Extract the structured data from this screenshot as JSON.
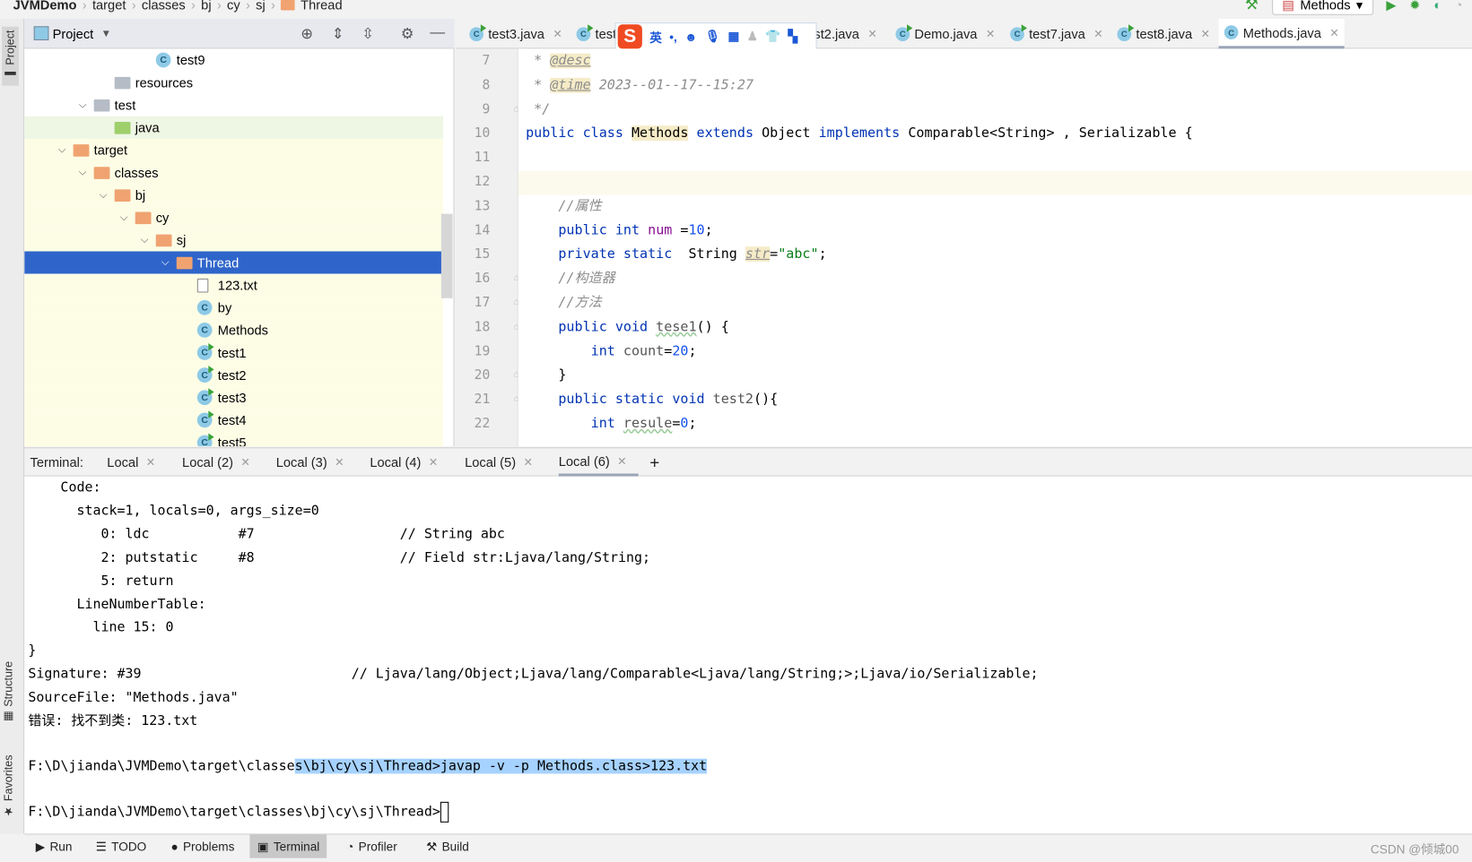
{
  "breadcrumb": [
    "JVMDemo",
    "target",
    "classes",
    "bj",
    "cy",
    "sj",
    "Thread"
  ],
  "toolbar": {
    "run_config": "Methods",
    "hammer_icon": "hammer-icon",
    "run_icon": "run-icon",
    "debug_icon": "debug-icon",
    "coverage_icon": "coverage-icon"
  },
  "left_strip": {
    "project": "Project",
    "structure": "Structure",
    "favorites": "Favorites"
  },
  "project_panel": {
    "title": "Project",
    "tree": [
      {
        "label": "test9",
        "icon": "cls",
        "level": 5
      },
      {
        "label": "resources",
        "icon": "res",
        "level": 3
      },
      {
        "label": "test",
        "icon": "plain",
        "level": 2,
        "expanded": true
      },
      {
        "label": "java",
        "icon": "gfold",
        "level": 3,
        "highlight": true
      },
      {
        "label": "target",
        "icon": "fold",
        "level": 1,
        "expanded": true,
        "yellow": true
      },
      {
        "label": "classes",
        "icon": "fold",
        "level": 2,
        "expanded": true,
        "yellow": true
      },
      {
        "label": "bj",
        "icon": "fold",
        "level": 3,
        "expanded": true,
        "yellow": true
      },
      {
        "label": "cy",
        "icon": "fold",
        "level": 4,
        "expanded": true,
        "yellow": true
      },
      {
        "label": "sj",
        "icon": "fold",
        "level": 5,
        "expanded": true,
        "yellow": true
      },
      {
        "label": "Thread",
        "icon": "fold",
        "level": 6,
        "expanded": true,
        "selected": true
      },
      {
        "label": "123.txt",
        "icon": "txt",
        "level": 7,
        "yellow": true
      },
      {
        "label": "by",
        "icon": "cls",
        "level": 7,
        "yellow": true
      },
      {
        "label": "Methods",
        "icon": "cls",
        "level": 7,
        "yellow": true
      },
      {
        "label": "test1",
        "icon": "run",
        "level": 7,
        "yellow": true
      },
      {
        "label": "test2",
        "icon": "run",
        "level": 7,
        "yellow": true
      },
      {
        "label": "test3",
        "icon": "run",
        "level": 7,
        "yellow": true
      },
      {
        "label": "test4",
        "icon": "run",
        "level": 7,
        "yellow": true
      },
      {
        "label": "test5",
        "icon": "run",
        "level": 7,
        "yellow": true
      }
    ]
  },
  "editor_tabs": [
    {
      "label": "test3.java",
      "run": true
    },
    {
      "label": "test5",
      "run": true
    },
    {
      "label": "st2.java",
      "run": true
    },
    {
      "label": "Demo.java",
      "run": true
    },
    {
      "label": "test7.java",
      "run": true
    },
    {
      "label": "test8.java",
      "run": true
    },
    {
      "label": "Methods.java",
      "run": false,
      "active": true
    }
  ],
  "ime_toolbar": {
    "logo": "S",
    "lang": "英",
    "punct": "•,"
  },
  "editor": {
    "current_line": 12,
    "lines": [
      {
        "n": 7,
        "t": [
          [
            "cmt",
            " * "
          ],
          [
            "tag",
            "@desc"
          ]
        ]
      },
      {
        "n": 8,
        "t": [
          [
            "cmt",
            " * "
          ],
          [
            "tag",
            "@time"
          ],
          [
            "cmt",
            " 2023--01--17--15:27"
          ]
        ]
      },
      {
        "n": 9,
        "t": [
          [
            "cmt",
            " */"
          ]
        ]
      },
      {
        "n": 10,
        "t": [
          [
            "kw",
            "public class "
          ],
          [
            "hlw",
            "Methods"
          ],
          [
            "kw",
            " extends "
          ],
          [
            "",
            "Object "
          ],
          [
            "kw",
            "implements "
          ],
          [
            "",
            "Comparable<String> , Serializable {"
          ]
        ]
      },
      {
        "n": 11,
        "t": []
      },
      {
        "n": 12,
        "t": []
      },
      {
        "n": 13,
        "t": [
          [
            "cmt",
            "    //属性"
          ]
        ]
      },
      {
        "n": 14,
        "t": [
          [
            "kw",
            "    public int "
          ],
          [
            "fld",
            "num"
          ],
          [
            "",
            " ="
          ],
          [
            "num",
            "10"
          ],
          [
            "",
            ";"
          ]
        ]
      },
      {
        "n": 15,
        "t": [
          [
            "kw",
            "    private static  "
          ],
          [
            "",
            "String "
          ],
          [
            "tag",
            "str"
          ],
          [
            "",
            "="
          ],
          [
            "str",
            "\"abc\""
          ],
          [
            "",
            ";"
          ]
        ]
      },
      {
        "n": 16,
        "t": [
          [
            "cmt",
            "    //构造器"
          ]
        ]
      },
      {
        "n": 17,
        "t": [
          [
            "cmt",
            "    //方法"
          ]
        ]
      },
      {
        "n": 18,
        "t": [
          [
            "kw",
            "    public void "
          ],
          [
            "wav",
            "tese1"
          ],
          [
            "",
            "() {"
          ]
        ]
      },
      {
        "n": 19,
        "t": [
          [
            "kw",
            "        int "
          ],
          [
            "grey",
            "count"
          ],
          [
            "",
            "="
          ],
          [
            "num",
            "20"
          ],
          [
            "",
            ";"
          ]
        ]
      },
      {
        "n": 20,
        "t": [
          [
            "",
            "    }"
          ]
        ]
      },
      {
        "n": 21,
        "t": [
          [
            "kw",
            "    public static void "
          ],
          [
            "grey",
            "test2"
          ],
          [
            "",
            "(){"
          ]
        ]
      },
      {
        "n": 22,
        "t": [
          [
            "kw",
            "        int "
          ],
          [
            "wav",
            "resule"
          ],
          [
            "",
            "="
          ],
          [
            "num",
            "0"
          ],
          [
            "",
            ";"
          ]
        ]
      }
    ]
  },
  "terminal": {
    "label": "Terminal:",
    "tabs": [
      "Local",
      "Local (2)",
      "Local (3)",
      "Local (4)",
      "Local (5)",
      "Local (6)"
    ],
    "active_tab": 5,
    "add_icon": "+",
    "lines": [
      "    Code:",
      "      stack=1, locals=0, args_size=0",
      "         0: ldc           #7                  // String abc",
      "         2: putstatic     #8                  // Field str:Ljava/lang/String;",
      "         5: return",
      "      LineNumberTable:",
      "        line 15: 0",
      "}",
      "Signature: #39                          // Ljava/lang/Object;Ljava/lang/Comparable<Ljava/lang/String;>;Ljava/io/Serializable;",
      "SourceFile: \"Methods.java\"",
      "错误: 找不到类: 123.txt",
      ""
    ],
    "command_prefix": "F:\\D\\jianda\\JVMDemo\\target\\classe",
    "command_selected": "s\\bj\\cy\\sj\\Thread>javap -v -p Methods.class>123.txt",
    "prompt": "F:\\D\\jianda\\JVMDemo\\target\\classes\\bj\\cy\\sj\\Thread>"
  },
  "bottom_bar": [
    {
      "label": "Run",
      "icon": "▶"
    },
    {
      "label": "TODO",
      "icon": "☰"
    },
    {
      "label": "Problems",
      "icon": "●"
    },
    {
      "label": "Terminal",
      "icon": "▣",
      "active": true
    },
    {
      "label": "Profiler",
      "icon": "◔"
    },
    {
      "label": "Build",
      "icon": "⚒"
    }
  ],
  "watermark": "CSDN @倾城00"
}
